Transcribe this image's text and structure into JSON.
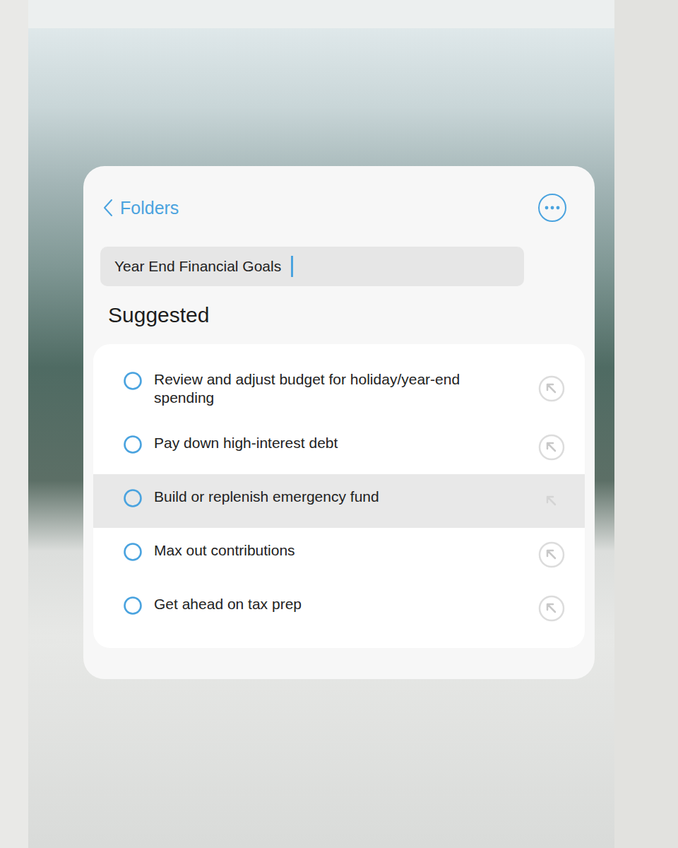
{
  "nav": {
    "back_label": "Folders"
  },
  "note": {
    "title": "Year End Financial Goals"
  },
  "section": {
    "title": "Suggested"
  },
  "suggestions": [
    {
      "text": "Review and adjust budget for holiday/year-end spending",
      "selected": false
    },
    {
      "text": "Pay down high-interest debt",
      "selected": false
    },
    {
      "text": "Build or replenish emergency fund",
      "selected": true
    },
    {
      "text": "Max out contributions",
      "selected": false
    },
    {
      "text": "Get ahead on tax prep",
      "selected": false
    }
  ]
}
